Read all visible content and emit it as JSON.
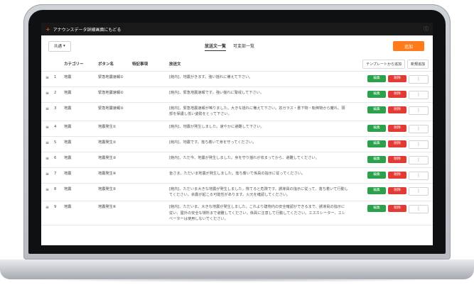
{
  "app": {
    "title": "アナウンスデータ詳細画面にもどる",
    "back_icon": "+",
    "user_initial": "ⓘ"
  },
  "toolbar": {
    "select_value": "共通",
    "select_caret": "▾",
    "tabs": [
      "放送文一覧",
      "可変部一覧"
    ],
    "add_label": "追加"
  },
  "table": {
    "headers": [
      "カテゴリー",
      "ボタン名",
      "特記事項",
      "放送文"
    ],
    "header_buttons": [
      "テンプレートから追加",
      "新規追加"
    ],
    "action_labels": {
      "edit": "編集",
      "delete": "削除",
      "more": "⋮"
    },
    "rows": [
      {
        "num": "1",
        "category": "地震",
        "button": "緊急地震速報①",
        "note": "",
        "text": "[館内]、地震がきます。強い揺れに備えて下さい。"
      },
      {
        "num": "2",
        "category": "地震",
        "button": "緊急地震速報②",
        "note": "",
        "text": "[館内]、緊急地震速報です。強い揺れに警戒して下さい。"
      },
      {
        "num": "3",
        "category": "地震",
        "button": "緊急地震速報③",
        "note": "",
        "text": "[館内]、緊急地震速報が鳴りました。大きな揺れに備えて下さい。窓ガラス・書下物・転倒物から離れ、頭部を保護し低い姿勢をとって下さい。"
      },
      {
        "num": "4",
        "category": "地震",
        "button": "地震発生①",
        "note": "",
        "text": "[館内]、地震が発生しました。速やかに避難して下さい。"
      },
      {
        "num": "5",
        "category": "地震",
        "button": "地震発生②",
        "note": "",
        "text": "[館内]、地震です。落ち着いて身を守ってください。"
      },
      {
        "num": "6",
        "category": "地震",
        "button": "地震発生③",
        "note": "",
        "text": "[館内]、ただ今、地震が発生しました。身を守り揺れが収まってから、避難してください。"
      },
      {
        "num": "7",
        "category": "地震",
        "button": "地震発生④",
        "note": "",
        "text": "皆さま、ただいま地震が発生しました。落ち着いて係員の指示に従ってください。"
      },
      {
        "num": "8",
        "category": "地震",
        "button": "地震発生⑤",
        "note": "",
        "text": "[館内]、ただいま大きな地震が発生しました。慌てると危険です。誘導員の指示に従って、落ち着いて行動してください。余震が起こる可能性があります。火元を確認してください。"
      },
      {
        "num": "9",
        "category": "地震",
        "button": "地震発生⑥",
        "note": "",
        "text": "[館内]、ただいま、大きな地震が発生しました。これより建物内の安全確認ができるまで、誘導員の指示に従い、屋外の安全な場所まで避難してください。係員に注意して行動してください。エスカレーター、エレベーターは使用しないでください。"
      }
    ]
  },
  "colors": {
    "accent": "#ff7a1a",
    "edit": "#2aa14a",
    "delete": "#e23b36",
    "topbar": "#191919"
  }
}
